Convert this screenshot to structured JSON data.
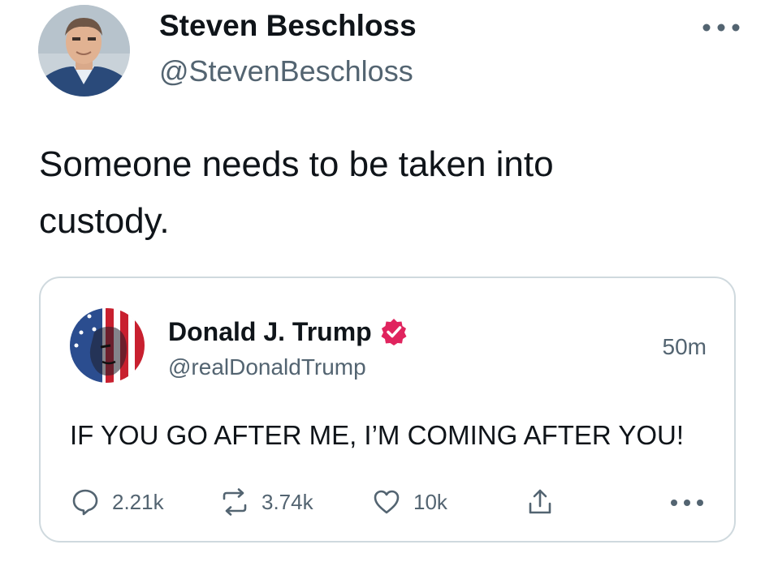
{
  "tweet": {
    "author": {
      "name": "Steven Beschloss",
      "handle": "@StevenBeschloss",
      "avatar_icon": "profile-photo"
    },
    "more_icon": "more-horizontal-icon",
    "text": "Someone needs to be taken into custody."
  },
  "quoted_post": {
    "author": {
      "name": "Donald J. Trump",
      "handle": "@realDonaldTrump",
      "verified_icon": "verified-badge-icon",
      "verified_color": "#e0245e",
      "avatar_icon": "flag-face-profile-photo"
    },
    "timestamp": "50m",
    "text": "IF YOU GO AFTER ME, I’M COMING AFTER YOU!",
    "actions": {
      "replies": "2.21k",
      "reposts": "3.74k",
      "likes": "10k"
    },
    "more_icon": "more-horizontal-icon"
  },
  "colors": {
    "text_primary": "#0f1419",
    "text_secondary": "#536471",
    "border": "#cfd9de"
  }
}
